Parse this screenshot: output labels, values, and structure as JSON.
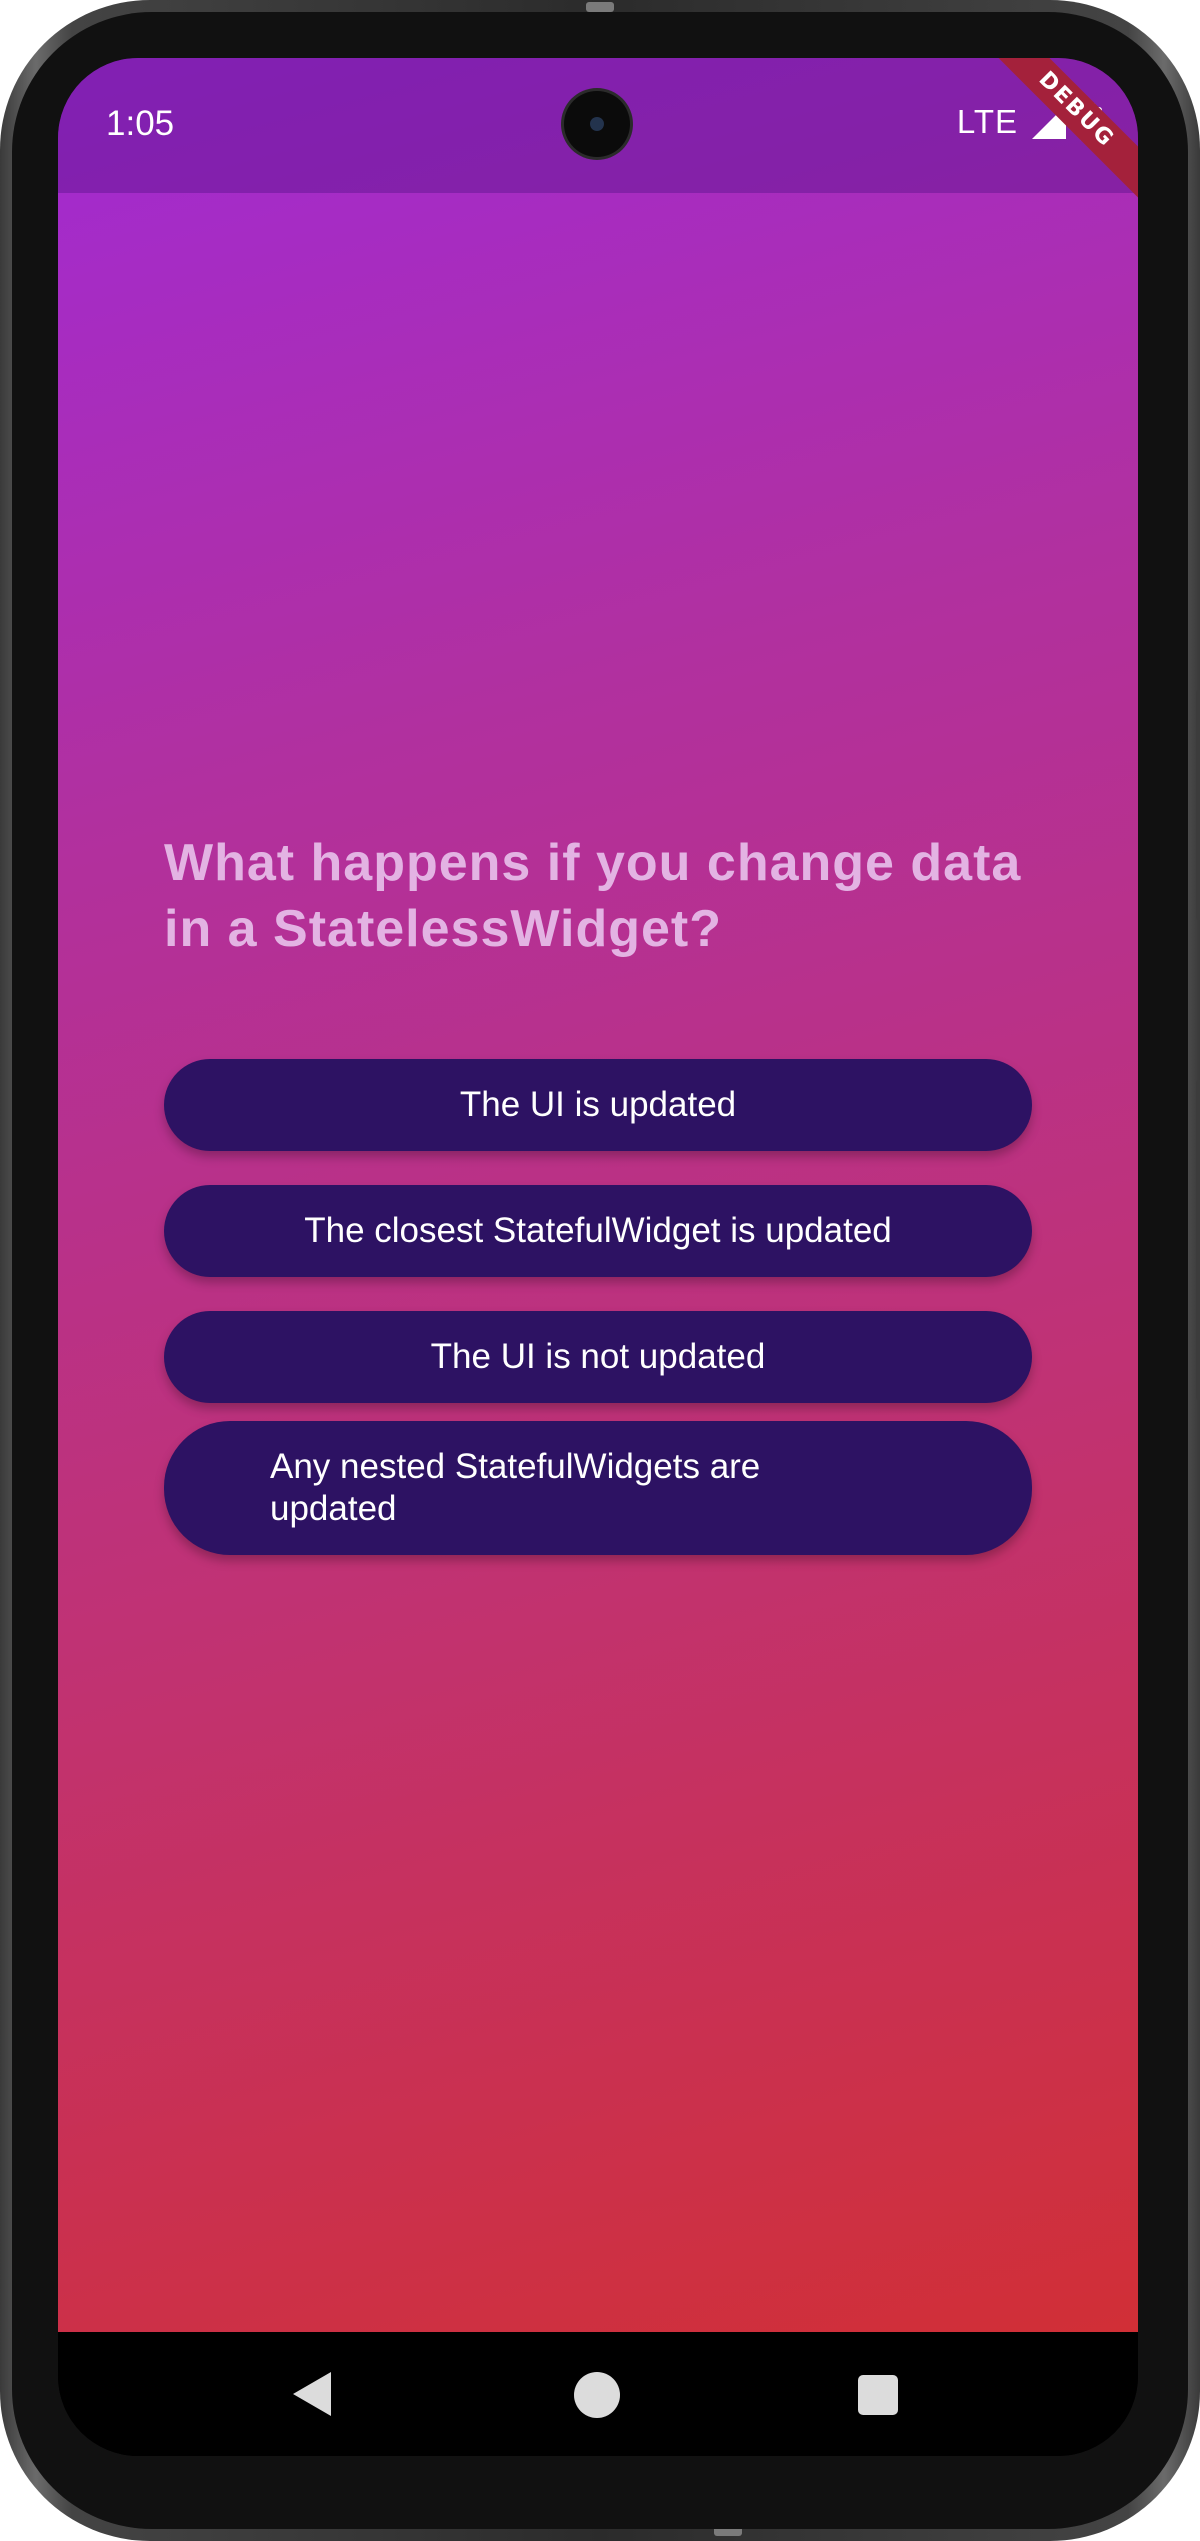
{
  "status_bar": {
    "time": "1:05",
    "network": "LTE",
    "signal_icon": "signal-icon",
    "battery_icon": "battery-icon"
  },
  "debug_banner": "DEBUG",
  "quiz": {
    "question": "What happens if you change data in a StatelessWidget?",
    "answers": [
      "The UI is updated",
      "The closest StatefulWidget is updated",
      "The UI is not updated",
      "Any nested StatefulWidgets are updated"
    ]
  },
  "nav_bar": {
    "back_icon": "back-triangle-icon",
    "home_icon": "home-circle-icon",
    "recents_icon": "recents-square-icon"
  },
  "colors": {
    "gradient_start": "#a12ad4",
    "gradient_end": "#d12f36",
    "question_text": "#e3b3e3",
    "answer_button": "#2d1263",
    "debug_banner": "#a4213b"
  }
}
